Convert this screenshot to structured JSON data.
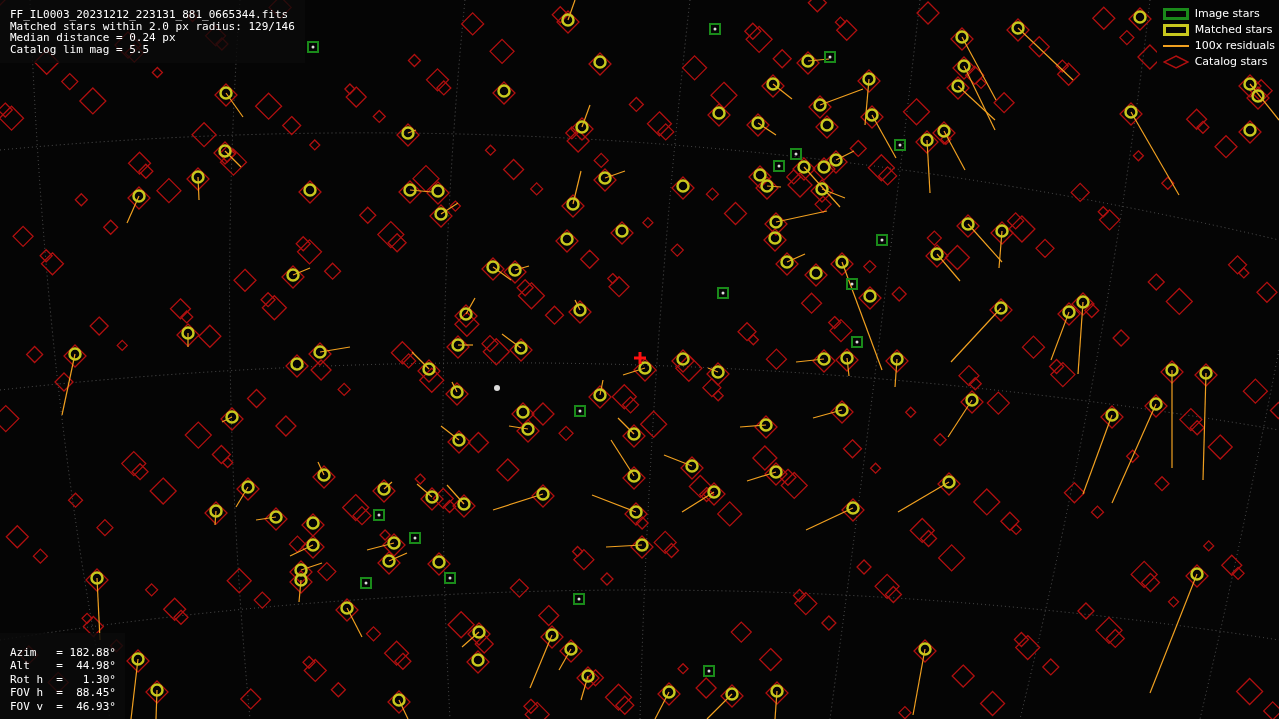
{
  "info": {
    "lines": [
      "FF_IL0003_20231212_223131_881_0665344.fits",
      "Matched stars within 2.0 px radius: 129/146",
      "Median distance = 0.24 px",
      "Catalog lim mag = 5.5"
    ]
  },
  "legend": [
    {
      "label": "Image stars",
      "kind": "square",
      "color": "#1a8a1a"
    },
    {
      "label": "Matched stars",
      "kind": "square",
      "color": "#c8c81e"
    },
    {
      "label": "100x residuals",
      "kind": "line",
      "color": "#f0a020"
    },
    {
      "label": "Catalog stars",
      "kind": "diamond",
      "color": "#b01010"
    }
  ],
  "pointing": {
    "lines": [
      "Azim   = 182.88°",
      "Alt    =  44.98°",
      "Rot h  =   1.30°",
      "FOV h  =  88.45°",
      "FOV v  =  46.93°"
    ]
  }
}
